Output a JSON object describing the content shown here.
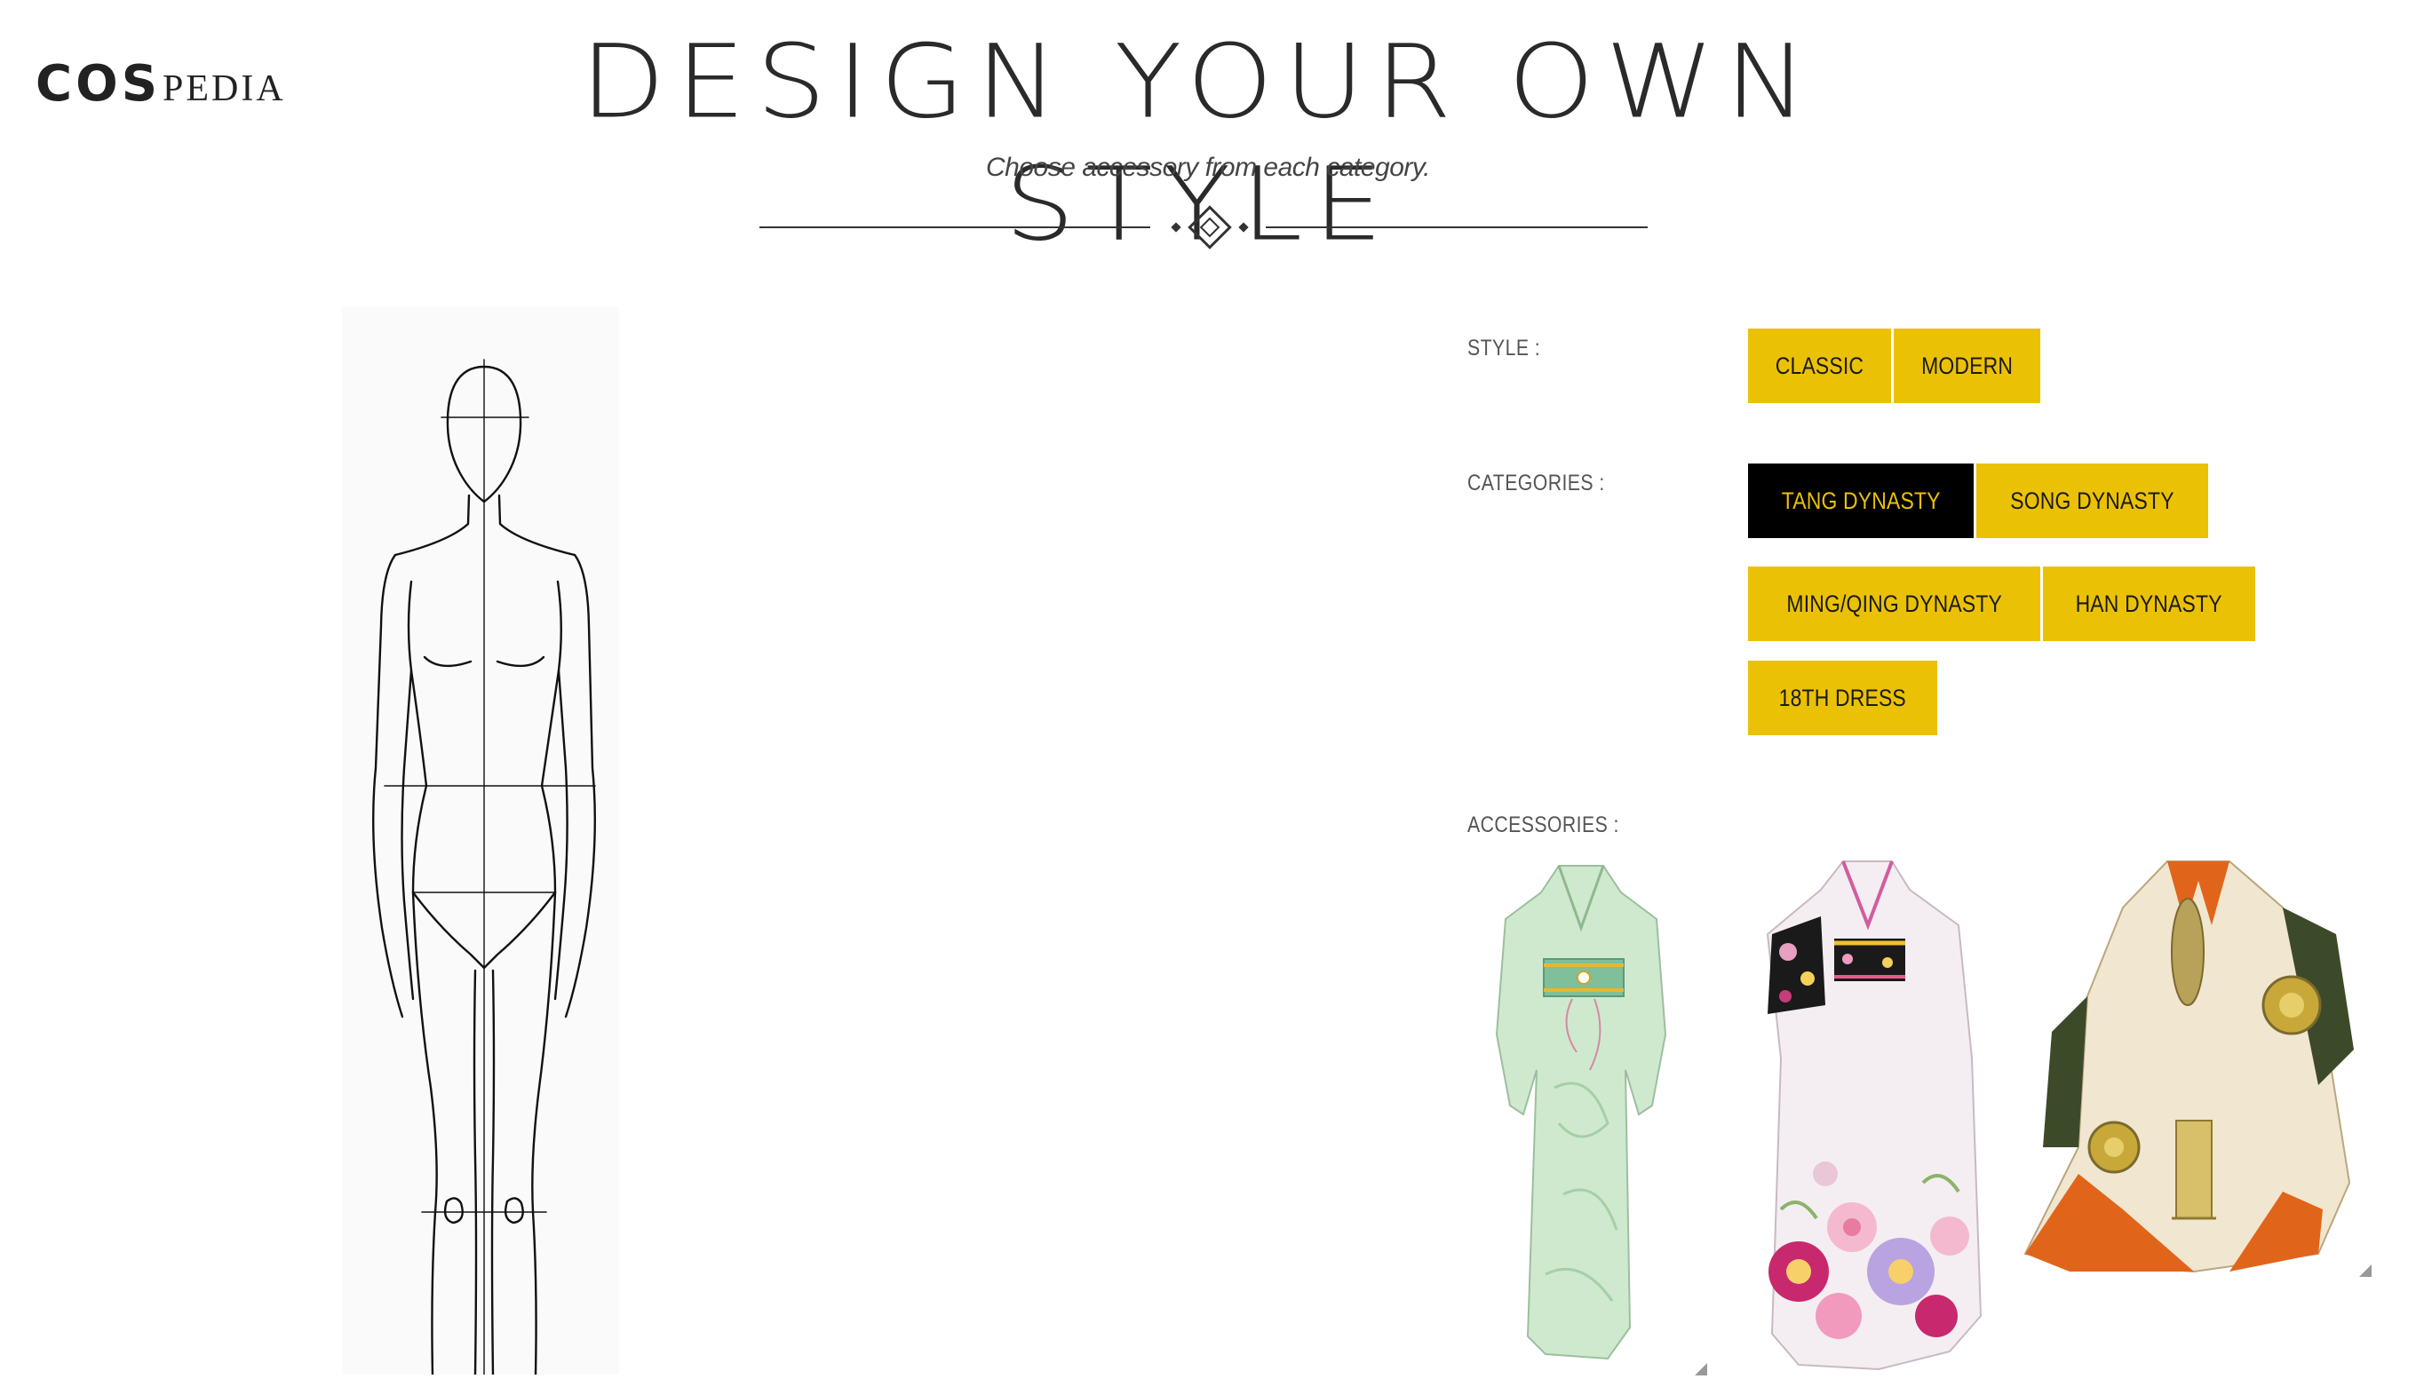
{
  "logo": {
    "cos": "COS",
    "pedia": "PEDIA"
  },
  "header": {
    "title": "DESIGN YOUR OWN STYLE",
    "subtitle": "Choose accessory from each category."
  },
  "style": {
    "label": "STYLE :",
    "options": [
      "CLASSIC",
      "MODERN"
    ]
  },
  "categories": {
    "label": "CATEGORIES :",
    "options": [
      "TANG DYNASTY",
      "SONG DYNASTY",
      "MING/QING DYNASTY",
      "HAN DYNASTY",
      "18TH DRESS"
    ],
    "selected": "TANG DYNASTY"
  },
  "accessories": {
    "label": "ACCESSORIES :",
    "items": [
      "mint-green-kimono",
      "white-floral-furisode",
      "white-orange-warrior-robe"
    ]
  },
  "colors": {
    "accent": "#ebc106",
    "selected_bg": "#000000",
    "selected_fg": "#ebc106"
  }
}
